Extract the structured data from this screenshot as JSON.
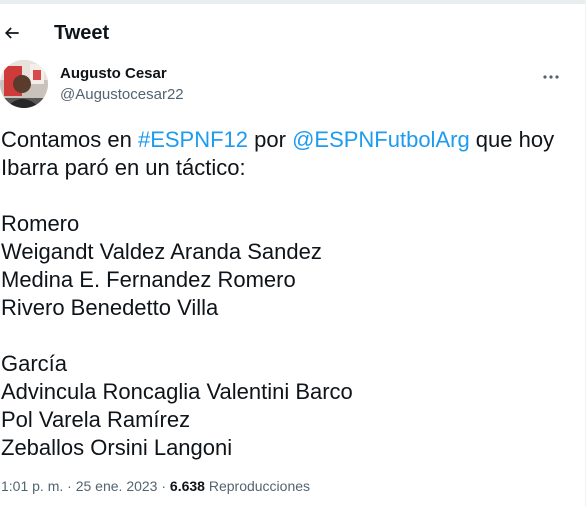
{
  "header": {
    "title": "Tweet"
  },
  "author": {
    "name": "Augusto Cesar",
    "handle": "@Augustocesar22"
  },
  "tweet": {
    "intro_1_before": "Contamos en ",
    "hashtag": "#ESPNF12",
    "intro_1_middle": " por ",
    "mention": "@ESPNFutbolArg",
    "intro_1_after": " que hoy",
    "intro_2": "Ibarra paró en un táctico:",
    "lines_a": [
      "Romero",
      "Weigandt Valdez Aranda Sandez",
      "Medina E. Fernandez Romero",
      "Rivero Benedetto Villa"
    ],
    "lines_b": [
      "García",
      "Advincula Roncaglia Valentini Barco",
      "Pol Varela Ramírez",
      "Zeballos Orsini Langoni"
    ]
  },
  "meta": {
    "time": "1:01 p. m.",
    "sep1": " · ",
    "date": "25 ene. 2023",
    "sep2": " · ",
    "views_count": "6.638",
    "views_label": " Reproducciones"
  },
  "icons": {
    "back": "arrow-left-icon",
    "more": "more-horizontal-icon"
  },
  "colors": {
    "link": "#1d9bf0",
    "secondary_text": "#536471",
    "primary_text": "#0f1419"
  }
}
